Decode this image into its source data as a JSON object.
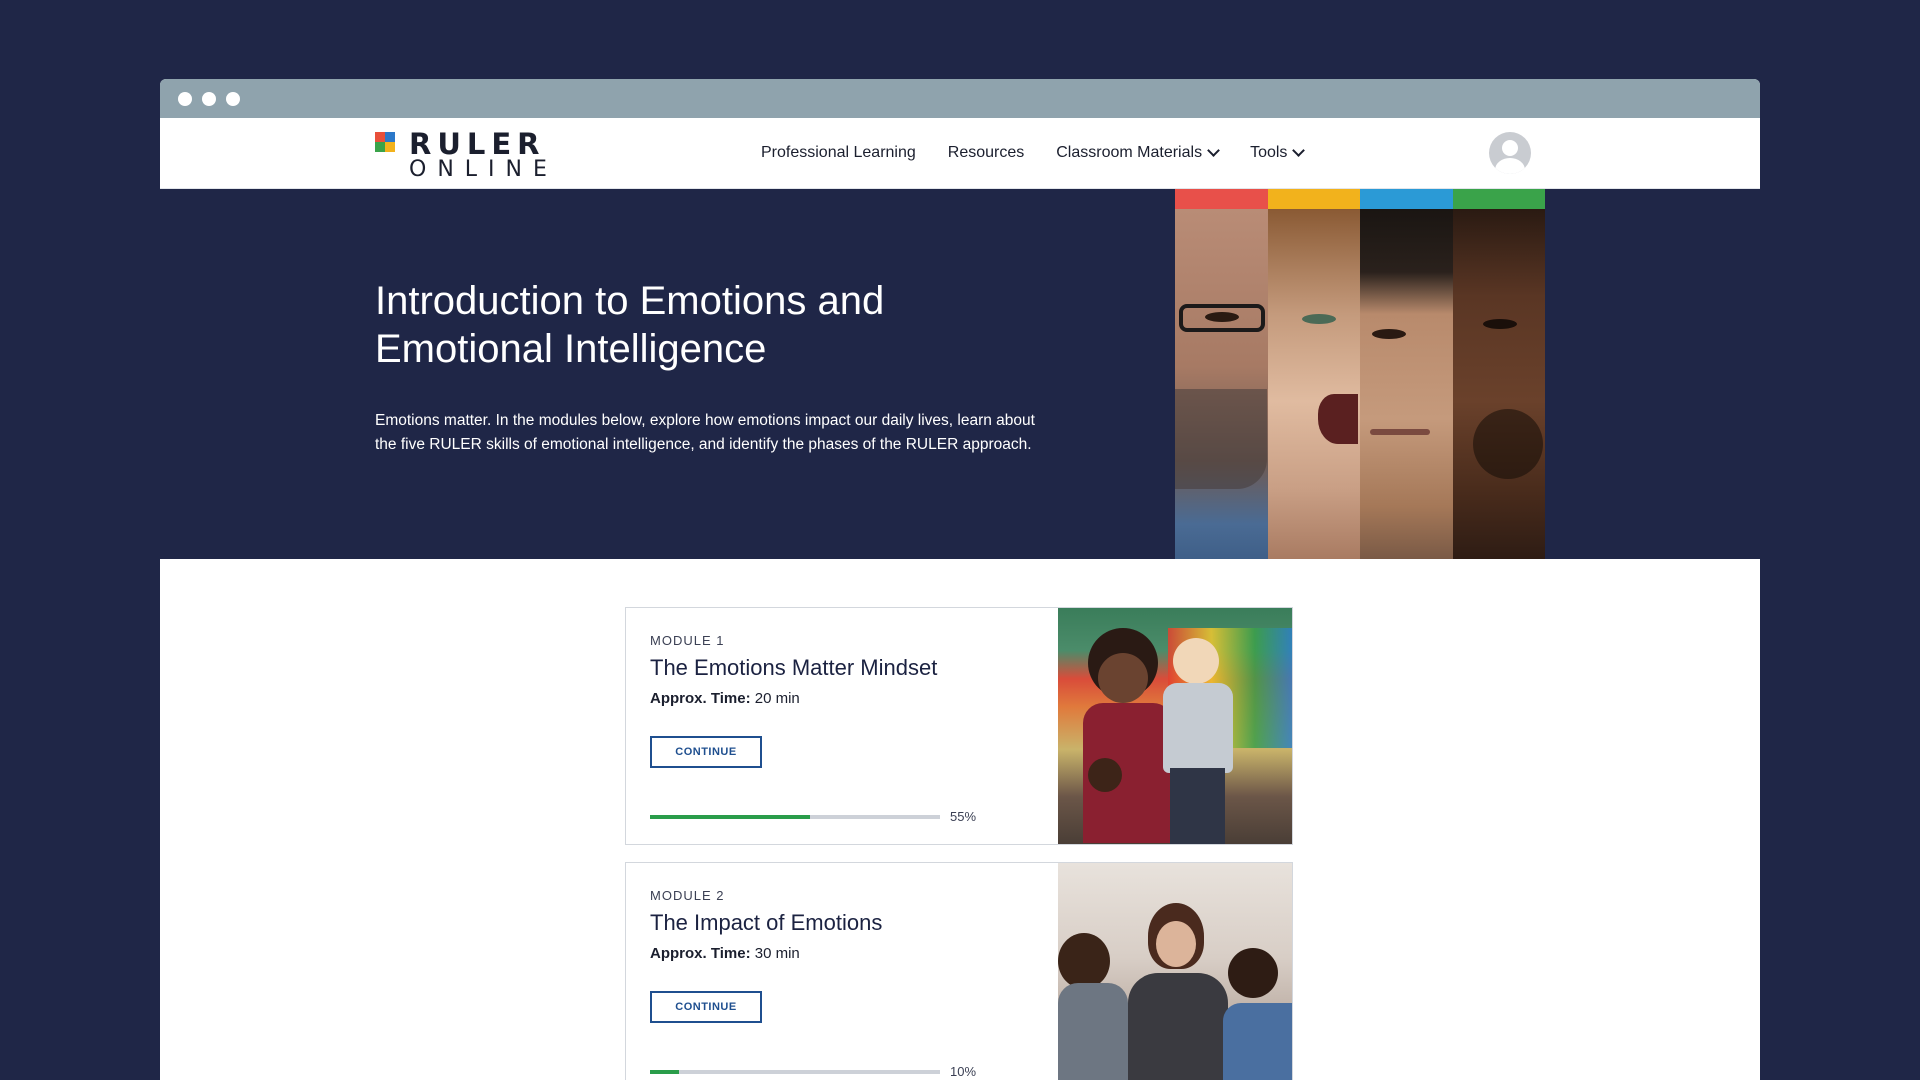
{
  "brand": {
    "name_top": "RULER",
    "name_bottom": "ONLINE",
    "logo_colors": [
      "#e8503a",
      "#2b78c9",
      "#3aa34a",
      "#f2b21c"
    ]
  },
  "nav": {
    "items": [
      {
        "label": "Professional Learning",
        "dropdown": false
      },
      {
        "label": "Resources",
        "dropdown": false
      },
      {
        "label": "Classroom Materials",
        "dropdown": true
      },
      {
        "label": "Tools",
        "dropdown": true
      }
    ],
    "avatar_icon": "user-avatar-icon"
  },
  "hero": {
    "title": "Introduction to Emotions and Emotional Intelligence",
    "description": "Emotions matter. In the modules below, explore how emotions impact our daily lives, learn about the five RULER skills of emotional intelligence, and identify the phases of the RULER approach.",
    "strip_colors": [
      "#e8504a",
      "#f2b21c",
      "#2b9ad6",
      "#3aa34a"
    ]
  },
  "modules": [
    {
      "label": "MODULE 1",
      "title": "The Emotions Matter Mindset",
      "time_label": "Approx. Time:",
      "time_value": "20 min",
      "button": "CONTINUE",
      "progress": 55,
      "progress_text": "55%"
    },
    {
      "label": "MODULE 2",
      "title": "The Impact of Emotions",
      "time_label": "Approx. Time:",
      "time_value": "30 min",
      "button": "CONTINUE",
      "progress": 10,
      "progress_text": "10%"
    }
  ],
  "colors": {
    "background": "#1f2647",
    "accent": "#1f4f8f",
    "progress": "#2a9d4a"
  }
}
